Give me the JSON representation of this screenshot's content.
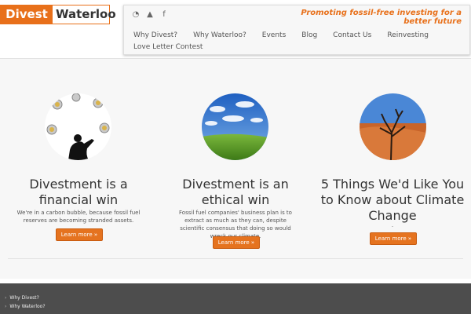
{
  "header": {
    "logo_part1": "Divest",
    "logo_part2": "Waterloo",
    "tagline": "Promoting fossil-free investing for a better future",
    "social": [
      {
        "icon": "rss-icon",
        "glyph": "◔"
      },
      {
        "icon": "twitter-icon",
        "glyph": "▲"
      },
      {
        "icon": "facebook-icon",
        "glyph": "f"
      }
    ],
    "nav": [
      "Why Divest?",
      "Why Waterloo?",
      "Events",
      "Blog",
      "Contact Us",
      "Reinvesting",
      "Love Letter Contest"
    ]
  },
  "columns": [
    {
      "title": "Divestment is a financial win",
      "text": "We're in a carbon bubble, because fossil fuel reserves are becoming stranded assets.",
      "button": "Learn more »"
    },
    {
      "title": "Divestment is an ethical win",
      "text": "Fossil fuel companies' business plan is to extract as much as they can, despite scientific consensus that doing so would wreck our climate.",
      "button": "Learn more »"
    },
    {
      "title": "5 Things We'd Like You to Know about Climate Change",
      "text": ".",
      "button": "Learn more »"
    }
  ],
  "footer": {
    "links": [
      "Why Divest?",
      "Why Waterloo?"
    ]
  }
}
